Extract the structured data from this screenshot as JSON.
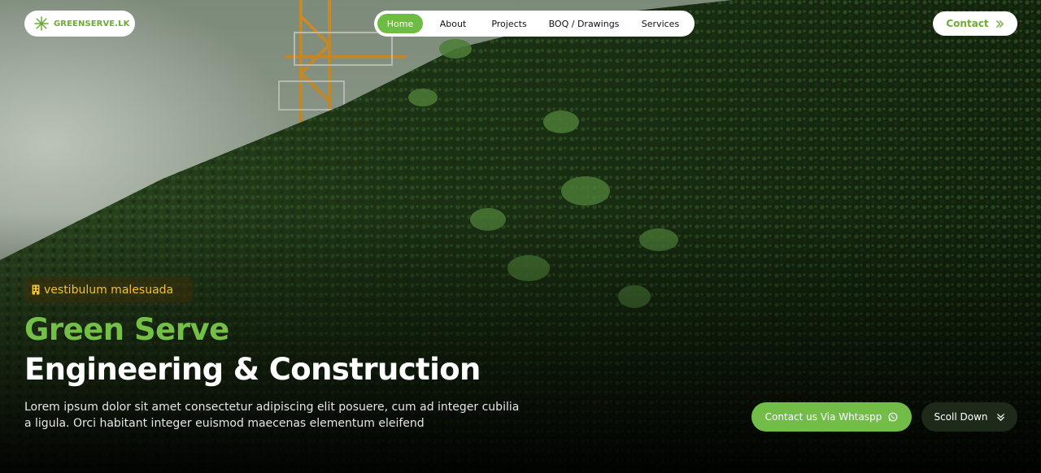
{
  "brand": {
    "name": "GREENSERVE.LK",
    "color": "#6aae35",
    "icon": "leaf-burst-icon"
  },
  "nav": {
    "items": [
      {
        "label": "Home",
        "active": true
      },
      {
        "label": "About",
        "active": false
      },
      {
        "label": "Projects",
        "active": false
      },
      {
        "label": "BOQ / Drawings",
        "active": false
      },
      {
        "label": "Services",
        "active": false
      }
    ],
    "active_color": "#6fbc45"
  },
  "contact": {
    "label": "Contact",
    "icon": "double-chevron-right-icon"
  },
  "hero": {
    "badge": {
      "label": "vestibulum malesuada",
      "icon": "building-icon",
      "color": "#f2c12e"
    },
    "title_line1": "Green Serve",
    "title_line2": "Engineering & Construction",
    "description": "Lorem ipsum dolor sit amet consectetur adipiscing elit posuere, cum ad integer cubilia a ligula. Orci habitant integer euismod maecenas elementum eleifend",
    "whatsapp_button": {
      "label": "Contact us Via Whtaspp",
      "icon": "whatsapp-icon"
    },
    "scroll_button": {
      "label": "Scoll Down",
      "icon": "double-chevron-down-icon"
    }
  }
}
